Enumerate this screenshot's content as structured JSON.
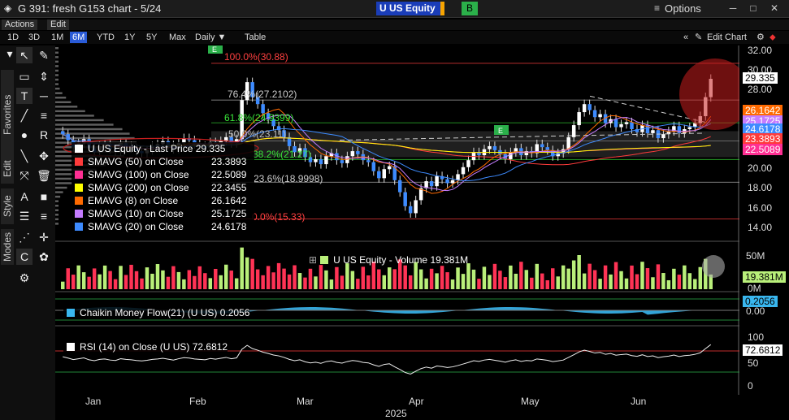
{
  "window": {
    "title": "G 391: fresh G153 chart - 5/24",
    "ticker": "U US Equity",
    "b_button": "B",
    "options_label": "Options"
  },
  "menus": [
    "Actions",
    "Edit"
  ],
  "toolbar": {
    "ranges": [
      "1D",
      "3D",
      "1M",
      "6M",
      "YTD",
      "1Y",
      "5Y",
      "Max"
    ],
    "active_range": "6M",
    "interval": "Daily",
    "table": "Table",
    "edit_chart": "Edit Chart"
  },
  "side_tabs": [
    "Favorites",
    "Edit",
    "Style",
    "Modes"
  ],
  "legend": {
    "title": "U US Equity - Last Price",
    "title_value": "29.335",
    "items": [
      {
        "label": "SMAVG (50)  on Close",
        "value": "23.3893",
        "color": "#ff3b3b"
      },
      {
        "label": "SMAVG (100)  on Close",
        "value": "22.5089",
        "color": "#ff2f93"
      },
      {
        "label": "SMAVG (200)  on Close",
        "value": "22.3455",
        "color": "#ffff00"
      },
      {
        "label": "EMAVG (8)  on Close",
        "value": "26.1642",
        "color": "#ff6a00"
      },
      {
        "label": "SMAVG (10)  on Close",
        "value": "25.1725",
        "color": "#c57cff"
      },
      {
        "label": "SMAVG (20)  on Close",
        "value": "24.6178",
        "color": "#3d8bff"
      }
    ]
  },
  "fib": [
    "100.0%(30.88)",
    "76.4%(27.2102)",
    "61.8%(24.9399)",
    "50.0%(23.11)",
    "38.2%(21.27)",
    "23.6%(18.9998)",
    "0.0%(15.33)"
  ],
  "price_axis": [
    "32.00",
    "30.00",
    "28.00",
    "26.00",
    "24.00",
    "22.00",
    "20.00",
    "18.00",
    "16.00",
    "14.00"
  ],
  "price_tags": [
    {
      "text": "29.335",
      "color": "#ffffff"
    },
    {
      "text": "26.1642",
      "color": "#ff6a00"
    },
    {
      "text": "25.1725",
      "color": "#c57cff"
    },
    {
      "text": "24.6178",
      "color": "#3d8bff"
    },
    {
      "text": "23.3893",
      "color": "#ff3b3b"
    },
    {
      "text": "22.5089",
      "color": "#ff2f93"
    }
  ],
  "volume": {
    "label": "U US Equity - Volume",
    "value": "19.381M",
    "axis": [
      "50M",
      "0M"
    ],
    "tag": "19.381M"
  },
  "cmf": {
    "label": "Chaikin Money Flow(21) (U US)",
    "value": "0.2056",
    "axis": "0.00",
    "tag": "0.2056"
  },
  "rsi": {
    "label": "RSI (14)  on Close (U US)",
    "value": "72.6812",
    "axis": [
      "100",
      "50",
      "0"
    ],
    "tag": "72.6812"
  },
  "months": [
    "Jan",
    "Feb",
    "Mar",
    "Apr",
    "May",
    "Jun"
  ],
  "year": "2025",
  "markers": [
    "E",
    "E"
  ],
  "chart_data": {
    "type": "candlestick",
    "title": "",
    "ylim": [
      13.5,
      32.5
    ],
    "closes": [
      23.8,
      23.2,
      22.5,
      22.9,
      23.3,
      22.4,
      22.0,
      22.6,
      22.8,
      22.3,
      22.1,
      22.9,
      22.6,
      22.4,
      22.1,
      21.9,
      22.2,
      22.6,
      22.8,
      23.1,
      22.7,
      22.3,
      22.9,
      23.4,
      23.2,
      22.8,
      22.6,
      22.4,
      23.0,
      22.7,
      23.1,
      23.5,
      22.9,
      23.3,
      27.2,
      29.0,
      27.5,
      26.8,
      25.9,
      25.3,
      24.6,
      24.2,
      23.5,
      22.6,
      22.0,
      22.4,
      21.5,
      21.0,
      21.3,
      20.8,
      21.6,
      21.9,
      21.2,
      20.9,
      21.6,
      22.1,
      21.8,
      21.2,
      21.0,
      20.1,
      19.4,
      20.3,
      20.6,
      19.2,
      18.0,
      16.6,
      15.9,
      17.2,
      18.4,
      19.1,
      18.6,
      19.6,
      19.3,
      18.9,
      19.2,
      19.8,
      20.5,
      21.2,
      22.0,
      21.7,
      22.3,
      22.6,
      22.2,
      21.8,
      21.3,
      22.0,
      22.4,
      21.7,
      22.1,
      21.9,
      22.8,
      22.5,
      22.2,
      21.6,
      21.9,
      22.3,
      23.5,
      24.7,
      26.0,
      26.8,
      26.2,
      25.5,
      25.8,
      24.9,
      25.3,
      24.5,
      24.8,
      25.0,
      24.3,
      24.0,
      24.7,
      23.9,
      24.2,
      23.4,
      23.8,
      24.1,
      24.6,
      23.9,
      24.3,
      24.5,
      24.9,
      25.6,
      27.5,
      29.33
    ],
    "volume_max_M": 60
  }
}
